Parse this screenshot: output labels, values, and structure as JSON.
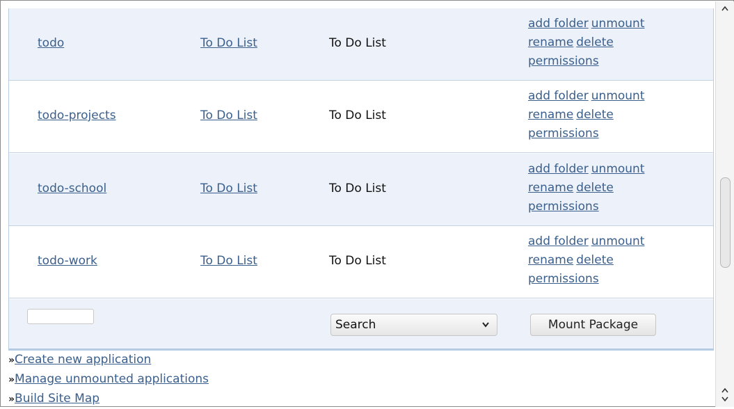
{
  "rows": [
    {
      "name": "todo",
      "package": "To Do List",
      "description": "To Do List"
    },
    {
      "name": "todo-projects",
      "package": "To Do List",
      "description": "To Do List"
    },
    {
      "name": "todo-school",
      "package": "To Do List",
      "description": "To Do List"
    },
    {
      "name": "todo-work",
      "package": "To Do List",
      "description": "To Do List"
    }
  ],
  "actions": {
    "add_folder": "add folder",
    "unmount": "unmount",
    "rename": "rename",
    "delete": "delete",
    "permissions": "permissions"
  },
  "footer": {
    "text_input_value": "",
    "select_value": "Search",
    "mount_button": "Mount Package"
  },
  "links": {
    "bullet": "»",
    "create": "Create new application",
    "manage": "Manage unmounted applications",
    "sitemap": "Build Site Map"
  },
  "scrollbar": {
    "up_icon": "chevron-up-icon",
    "down_icon": "chevron-down-icon"
  },
  "colors": {
    "alt_row": "#edf2fa",
    "link": "#3a5f8c",
    "border": "#b3cbe3"
  }
}
